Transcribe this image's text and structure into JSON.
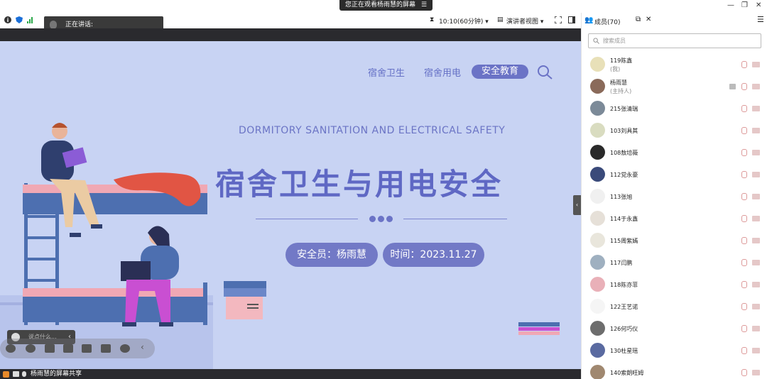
{
  "window": {
    "viewing_label": "您正在观看杨雨慧的屏幕",
    "menu_glyph": "☰",
    "controls": [
      "—",
      "❐",
      "✕"
    ]
  },
  "toolbar": {
    "speaking_label": "正在讲话:",
    "timer": "10:10(60分钟)",
    "view_mode": "演讲者视图",
    "chevron": "▾"
  },
  "slide": {
    "nav": [
      "宿舍卫生",
      "宿舍用电",
      "安全教育"
    ],
    "eng_title": "DORMITORY SANITATION AND ELECTRICAL SAFETY",
    "cn_title": "宿舍卫生与用电安全",
    "officer": "安全员：杨雨慧",
    "date": "时间：2023.11.27"
  },
  "chat": {
    "placeholder": "说点什么...",
    "collapse": "‹"
  },
  "bottom_bar": {
    "share_label": "杨雨慧的屏幕共享"
  },
  "panel": {
    "title": "成员(70)",
    "search_placeholder": "搜索成员",
    "members": [
      {
        "name": "119陈鑫",
        "sub": "(我)",
        "color": "#e8e0b8"
      },
      {
        "name": "杨雨慧",
        "sub": "(主持人)",
        "color": "#8a6a5a"
      },
      {
        "name": "215张清瑞",
        "sub": "",
        "color": "#7c8a98"
      },
      {
        "name": "103刘具其",
        "sub": "",
        "color": "#d9dcc0"
      },
      {
        "name": "108敖培薇",
        "sub": "",
        "color": "#2a2a2a"
      },
      {
        "name": "112党永豪",
        "sub": "",
        "color": "#3a4a7a"
      },
      {
        "name": "113张旭",
        "sub": "",
        "color": "#f0f0f0"
      },
      {
        "name": "114于永鑫",
        "sub": "",
        "color": "#e6e0d8"
      },
      {
        "name": "115周紫嫣",
        "sub": "",
        "color": "#e9e6dc"
      },
      {
        "name": "117闫鹏",
        "sub": "",
        "color": "#9fb0c0"
      },
      {
        "name": "118陈亦菲",
        "sub": "",
        "color": "#e9b0b8"
      },
      {
        "name": "122王艺诺",
        "sub": "",
        "color": "#f5f5f5"
      },
      {
        "name": "126何巧仪",
        "sub": "",
        "color": "#6d6d6d"
      },
      {
        "name": "130杜星瑶",
        "sub": "",
        "color": "#5a6aa0"
      },
      {
        "name": "140索朗旺姆",
        "sub": "",
        "color": "#a08870"
      }
    ]
  }
}
